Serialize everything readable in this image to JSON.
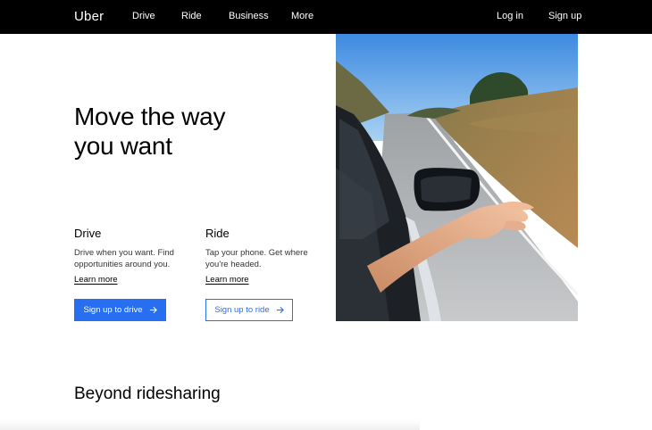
{
  "nav": {
    "logo": "Uber",
    "links": [
      "Drive",
      "Ride",
      "Business",
      "More"
    ],
    "login": "Log in",
    "signup": "Sign up"
  },
  "hero": {
    "title_line1": "Move the way",
    "title_line2": "you want"
  },
  "drive": {
    "title": "Drive",
    "description": "Drive when you want. Find opportunities around you.",
    "link": "Learn more",
    "button": "Sign up to drive"
  },
  "ride": {
    "title": "Ride",
    "description": "Tap your phone. Get where you're headed.",
    "link": "Learn more",
    "button": "Sign up to ride"
  },
  "section": {
    "title": "Beyond ridesharing"
  },
  "colors": {
    "nav_bg": "#000000",
    "accent": "#276EF1"
  },
  "icons": {
    "button_arrow": "arrow-right-icon"
  }
}
